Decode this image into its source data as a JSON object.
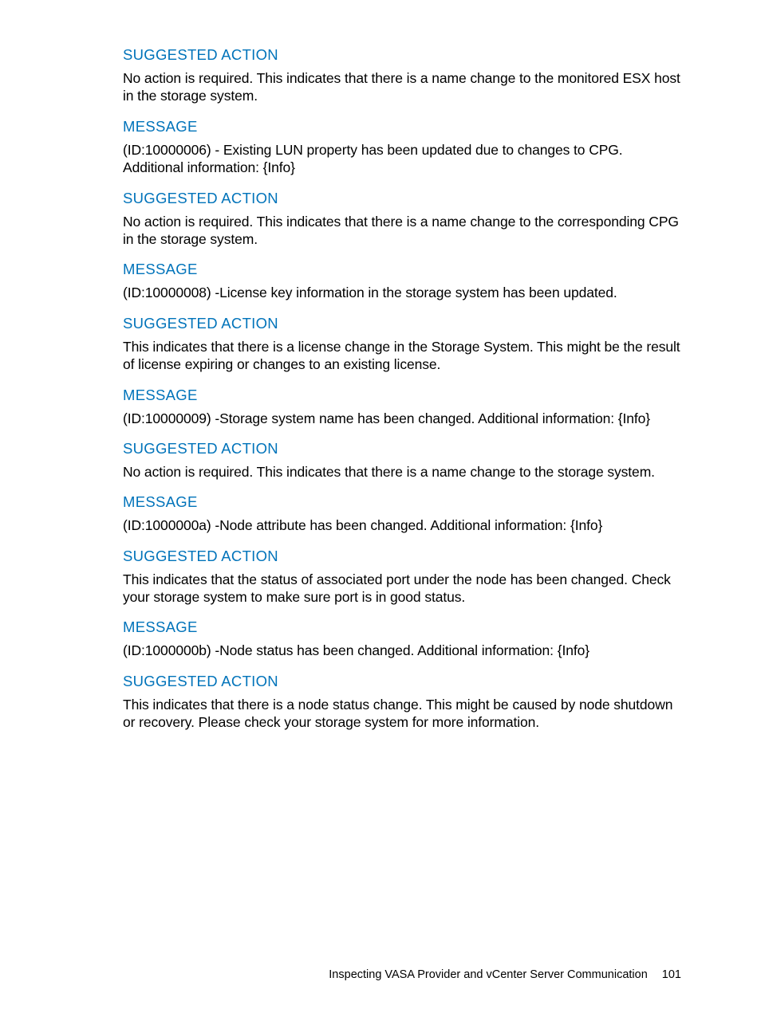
{
  "sections": [
    {
      "heading": "SUGGESTED ACTION",
      "body": "No action is required. This indicates that there is a name change to the monitored ESX host in the storage system."
    },
    {
      "heading": "MESSAGE",
      "body": "(ID:10000006) - Existing LUN property has been updated due to changes to CPG. Additional information: {Info}"
    },
    {
      "heading": "SUGGESTED ACTION",
      "body": "No action is required. This indicates that there is a name change to the corresponding CPG in the storage system."
    },
    {
      "heading": "MESSAGE",
      "body": "(ID:10000008) -License key information in the storage system has been updated."
    },
    {
      "heading": "SUGGESTED ACTION",
      "body": "This indicates that there is a license change in the Storage System. This might be the result of license expiring or changes to an existing license."
    },
    {
      "heading": "MESSAGE",
      "body": "(ID:10000009) -Storage system name has been changed. Additional information: {Info}"
    },
    {
      "heading": "SUGGESTED ACTION",
      "body": "No action is required. This indicates that there is a name change to the storage system."
    },
    {
      "heading": "MESSAGE",
      "body": "(ID:1000000a) -Node attribute has been changed. Additional information: {Info}"
    },
    {
      "heading": "SUGGESTED ACTION",
      "body": "This indicates that the status of associated port under the node has been changed. Check your storage system to make sure port is in good status."
    },
    {
      "heading": "MESSAGE",
      "body": "(ID:1000000b) -Node status has been changed. Additional information: {Info}"
    },
    {
      "heading": "SUGGESTED ACTION",
      "body": "This indicates that there is a node status change. This might be caused by node shutdown or recovery. Please check your storage system for more information."
    }
  ],
  "footer": {
    "title": "Inspecting VASA Provider and vCenter Server Communication",
    "page": "101"
  }
}
